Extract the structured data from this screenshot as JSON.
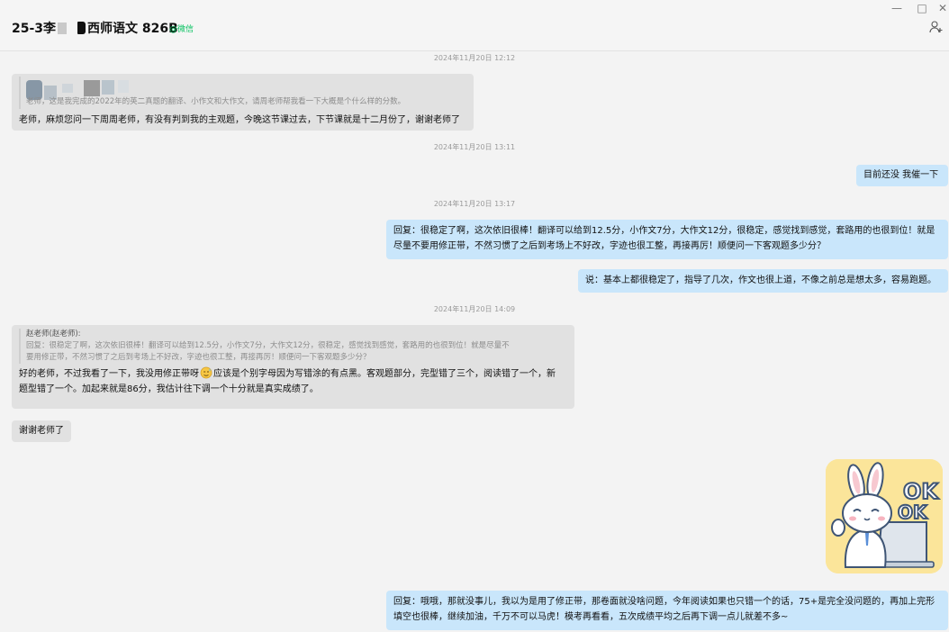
{
  "header": {
    "title_prefix": "25-3李",
    "title_main": "西师语文 826B",
    "tag": "@微信",
    "minimize": "—",
    "maximize": "□",
    "close": "✕"
  },
  "messages": {
    "t1": "2024年11月20日 12:12",
    "m1_quote": "老师，这是我完成的2022年的英二真题的翻译、小作文和大作文，请周老师帮我看一下大概是个什么样的分数。",
    "m1_text": "老师，麻烦您问一下周周老师，有没有判到我的主观题，今晚这节课过去，下节课就是十二月份了，谢谢老师了",
    "t2": "2024年11月20日 13:11",
    "m2_text": "目前还没  我催一下",
    "t3": "2024年11月20日 13:17",
    "m3_line1": "回复：很稳定了啊，这次依旧很棒！翻译可以给到12.5分，小作文7分，大作文12分，很稳定，感觉找到感觉，套路用的也很到位！就是",
    "m3_line2": "尽量不要用修正带，不然习惯了之后到考场上不好改，字迹也很工整，再接再厉！顺便问一下客观题多少分？",
    "m4_text": "说：基本上都很稳定了，指导了几次，作文也很上道，不像之前总是想太多，容易跑题。",
    "t4": "2024年11月20日 14:09",
    "m5_quote_name": "赵老师(赵老师):",
    "m5_quote_line1": "回复：很稳定了啊，这次依旧很棒！翻译可以给到12.5分，小作文7分，大作文12分，很稳定，感觉找到感觉，套路用的也很到位！就是尽量不",
    "m5_quote_line2": "要用修正带，不然习惯了之后到考场上不好改，字迹也很工整，再接再厉！顺便问一下客观题多少分？",
    "m5_line1_a": "好的老师，不过我看了一下，我没用修正带呀",
    "m5_line1_b": "应该是个别字母因为写错涂的有点黑。客观题部分，完型错了三个，阅读错了一个，新",
    "m5_line2": "题型错了一个。加起来就是86分，我估计往下调一个十分就是真实成绩了。",
    "m6_text": "谢谢老师了",
    "sticker_text": "OK",
    "m7_line1": "回复：哦哦，那就没事儿，我以为是用了修正带，那卷面就没啥问题，今年阅读如果也只错一个的话，75+是完全没问题的，再加上完形",
    "m7_line2": "填空也很棒，继续加油，千万不可以马虎！模考再看看，五次成绩平均之后再下调一点儿就差不多~"
  },
  "colors": {
    "bubble_in": "#e1e1e1",
    "bubble_out": "#c9e6fb",
    "tag_green": "#07c160",
    "background": "#f3f3f3"
  },
  "icons": [
    "add-user-icon",
    "sweat-emoji-icon",
    "bunny-ok-sticker"
  ]
}
